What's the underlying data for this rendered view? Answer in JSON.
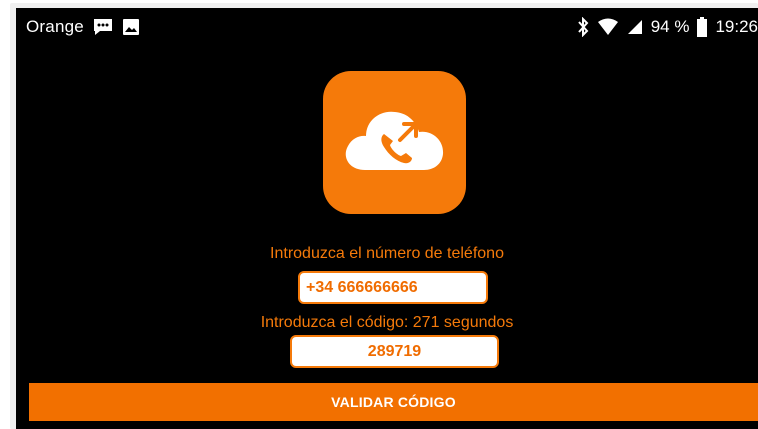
{
  "status_bar": {
    "carrier": "Orange",
    "battery": "94 %",
    "time": "19:26",
    "icons": [
      "message-icon",
      "image-icon",
      "bluetooth-icon",
      "wifi-icon",
      "signal-icon",
      "battery-icon"
    ]
  },
  "app": {
    "logo_icon": "cloud-phone-icon",
    "accent_color": "#f57a0a"
  },
  "form": {
    "phone_label": "Introduzca el número de teléfono",
    "phone_value": "+34 666666666",
    "code_label": "Introduzca el código: 271 segundos",
    "code_value": "289719",
    "validate_button": "VALIDAR CÓDIGO"
  }
}
